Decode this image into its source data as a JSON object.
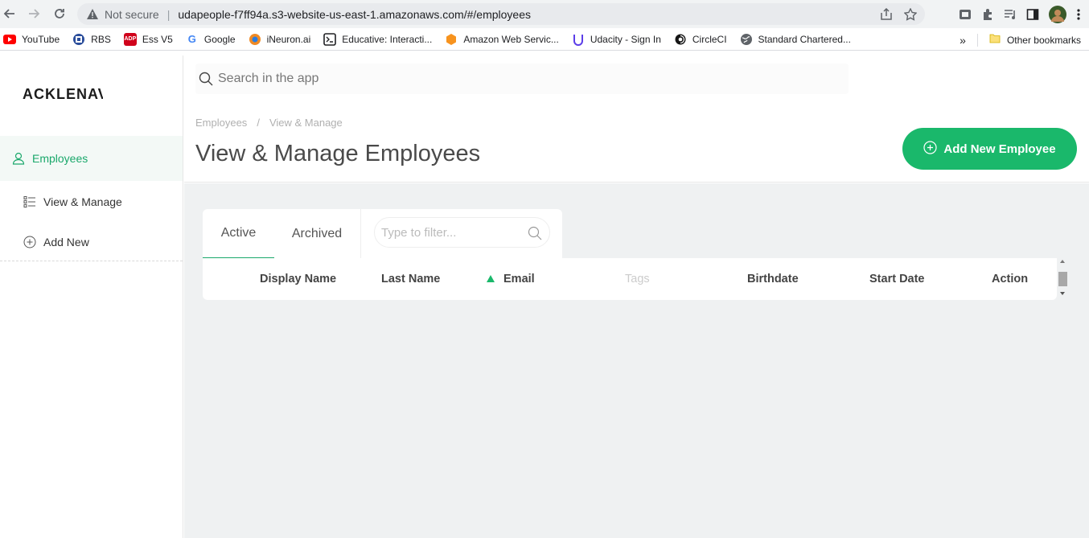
{
  "browser": {
    "not_secure_label": "Not secure",
    "url": "udapeople-f7ff94a.s3-website-us-east-1.amazonaws.com/#/employees",
    "bookmarks": [
      {
        "label": "YouTube",
        "icon": "youtube-icon",
        "color": "#ff0000"
      },
      {
        "label": "RBS",
        "icon": "rbs-icon",
        "color": "#2a4d9b"
      },
      {
        "label": "Ess V5",
        "icon": "adp-icon",
        "color": "#d0021b"
      },
      {
        "label": "Google",
        "icon": "google-icon",
        "color": "#4285f4"
      },
      {
        "label": "iNeuron.ai",
        "icon": "ineuron-icon",
        "color": "#f08a24"
      },
      {
        "label": "Educative: Interacti...",
        "icon": "educative-icon",
        "color": "#202124"
      },
      {
        "label": "Amazon Web Servic...",
        "icon": "aws-icon",
        "color": "#f7931e"
      },
      {
        "label": "Udacity - Sign In",
        "icon": "udacity-icon",
        "color": "#5c3ee8"
      },
      {
        "label": "CircleCI",
        "icon": "circleci-icon",
        "color": "#161616"
      },
      {
        "label": "Standard Chartered...",
        "icon": "globe-icon",
        "color": "#5f6368"
      }
    ],
    "more_bookmarks": "»",
    "other_bookmarks": "Other bookmarks"
  },
  "sidebar": {
    "logo": "ACKLENAVE",
    "items": [
      {
        "label": "Employees",
        "icon": "user-icon"
      },
      {
        "label": "View & Manage",
        "icon": "list-icon"
      },
      {
        "label": "Add New",
        "icon": "plus-circle-icon"
      }
    ]
  },
  "header": {
    "search_placeholder": "Search in the app",
    "breadcrumb": [
      "Employees",
      "/",
      "View & Manage"
    ],
    "title": "View & Manage Employees",
    "add_button": "Add New Employee"
  },
  "tabs": {
    "active": "Active",
    "archived": "Archived",
    "filter_placeholder": "Type to filter..."
  },
  "table": {
    "columns": [
      "Display Name",
      "Last Name",
      "Email",
      "Tags",
      "Birthdate",
      "Start Date",
      "Action"
    ],
    "sorted_column": "Email",
    "sort_direction": "ascending"
  },
  "colors": {
    "accent": "#1ab86b",
    "content_bg": "#eff1f2"
  }
}
